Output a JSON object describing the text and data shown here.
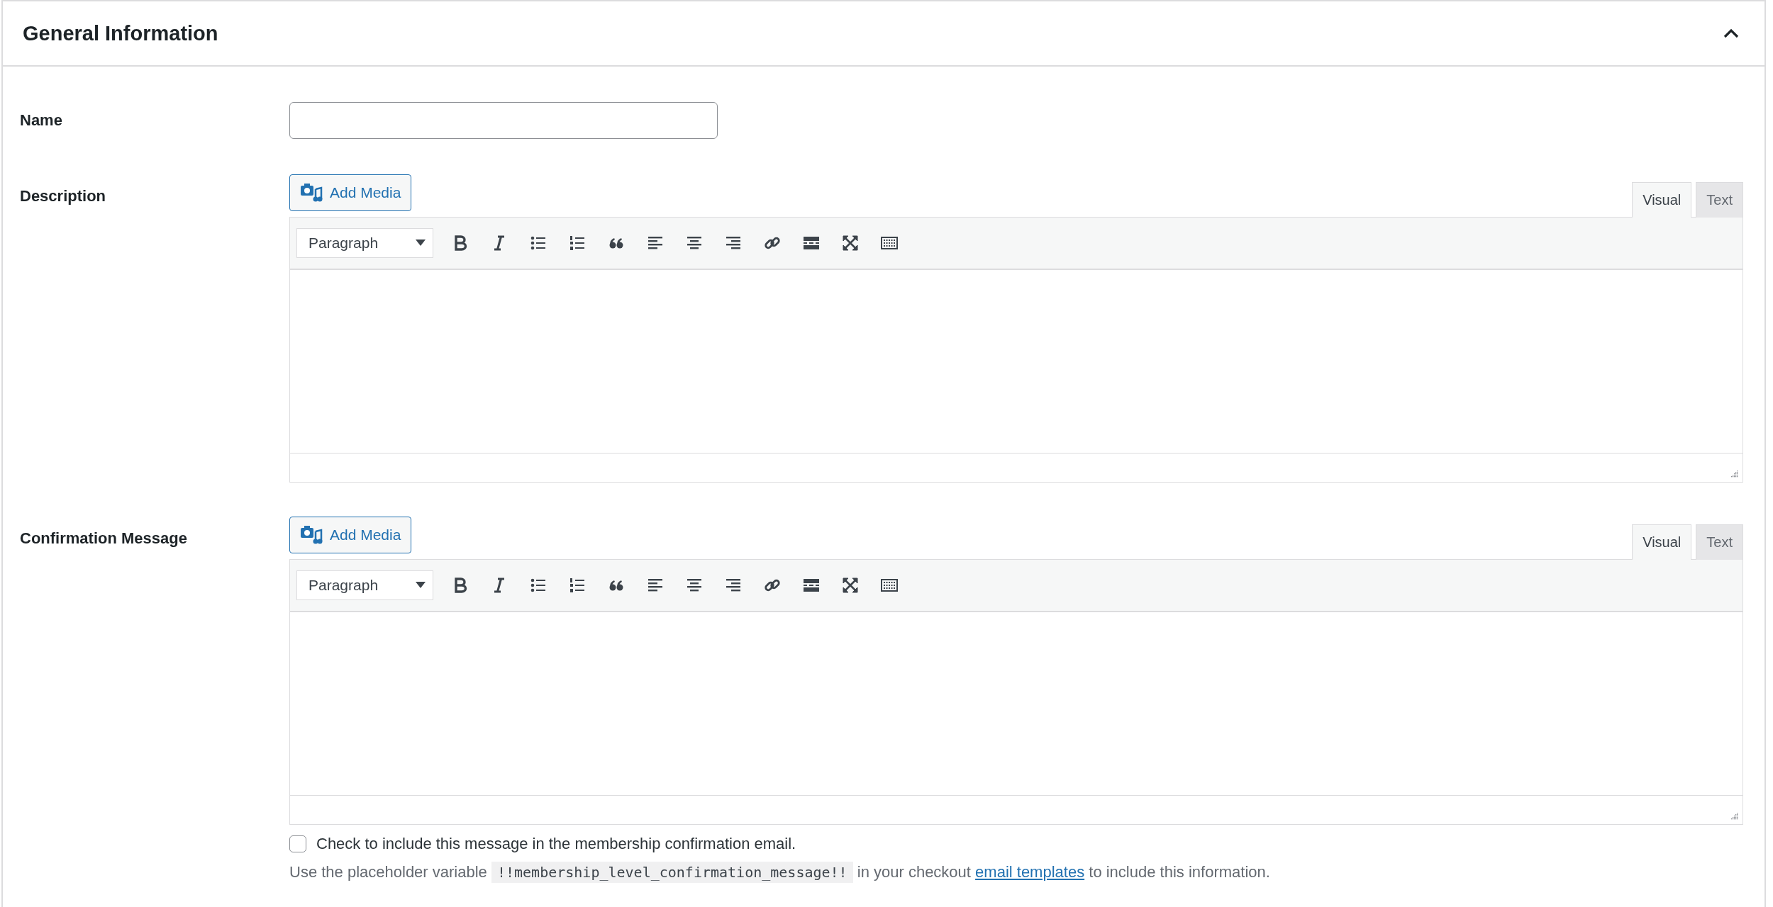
{
  "panel": {
    "title": "General Information",
    "expanded": true
  },
  "fields": [
    {
      "kind": "text",
      "label": "Name"
    },
    {
      "kind": "editor",
      "label": "Description",
      "add_media": "Add Media",
      "format": "Paragraph",
      "tabs": [
        {
          "label": "Visual",
          "selected": true
        },
        {
          "label": "Text",
          "selected": false
        }
      ]
    },
    {
      "kind": "editor",
      "label": "Confirmation Message",
      "add_media": "Add Media",
      "format": "Paragraph",
      "tabs": [
        {
          "label": "Visual",
          "selected": true
        },
        {
          "label": "Text",
          "selected": false
        }
      ]
    }
  ],
  "include_checkbox": {
    "label": "Check to include this message in the membership confirmation email.",
    "checked": false
  },
  "hint": {
    "before": "Use the placeholder variable",
    "code": "!!membership_level_confirmation_message!!",
    "middle": "in your checkout",
    "link": "email templates",
    "after": "to include this information."
  }
}
